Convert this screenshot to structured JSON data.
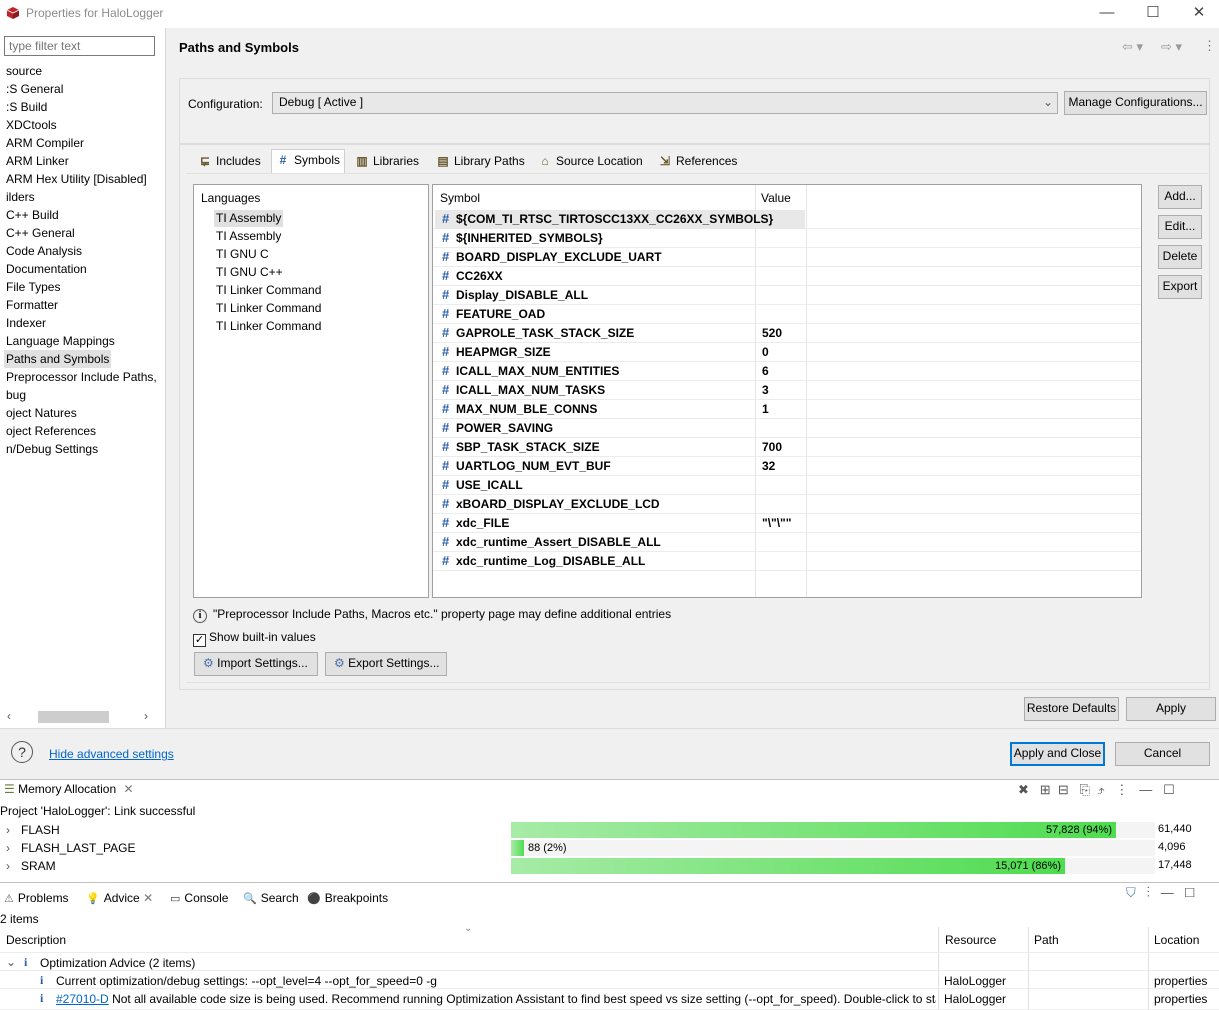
{
  "window": {
    "title": "Properties for HaloLogger",
    "minimize": "—",
    "maximize": "☐",
    "close": "✕"
  },
  "left_nav": {
    "filter_placeholder": "type filter text",
    "items": [
      {
        "label": "source"
      },
      {
        "label": ":S General"
      },
      {
        "label": ":S Build"
      },
      {
        "label": "XDCtools"
      },
      {
        "label": "ARM Compiler"
      },
      {
        "label": "ARM Linker"
      },
      {
        "label": "ARM Hex Utility  [Disabled]"
      },
      {
        "label": "ilders"
      },
      {
        "label": "C++ Build"
      },
      {
        "label": "C++ General"
      },
      {
        "label": "Code Analysis"
      },
      {
        "label": "Documentation"
      },
      {
        "label": "File Types"
      },
      {
        "label": "Formatter"
      },
      {
        "label": "Indexer"
      },
      {
        "label": "Language Mappings"
      },
      {
        "label": "Paths and Symbols"
      },
      {
        "label": "Preprocessor Include Paths,"
      },
      {
        "label": "bug"
      },
      {
        "label": "oject Natures"
      },
      {
        "label": "oject References"
      },
      {
        "label": "n/Debug Settings"
      }
    ],
    "selected_index": 16
  },
  "page": {
    "title": "Paths and Symbols",
    "config_label": "Configuration:",
    "config_value": "Debug  [ Active ]",
    "manage_button": "Manage Configurations...",
    "tabs": [
      {
        "label": "Includes",
        "icon": "includes-icon"
      },
      {
        "label": "Symbols",
        "icon": "hash-icon"
      },
      {
        "label": "Libraries",
        "icon": "libraries-icon"
      },
      {
        "label": "Library Paths",
        "icon": "library-paths-icon"
      },
      {
        "label": "Source Location",
        "icon": "source-location-icon"
      },
      {
        "label": "References",
        "icon": "references-icon"
      }
    ],
    "active_tab": 1,
    "languages_header": "Languages",
    "languages": [
      "TI Assembly",
      "TI Assembly",
      "TI GNU C",
      "TI GNU C++",
      "TI Linker Command",
      "TI Linker Command",
      "TI Linker Command"
    ],
    "selected_language": 0,
    "symbol_header": "Symbol",
    "value_header": "Value",
    "symbols": [
      {
        "name": "${COM_TI_RTSC_TIRTOSCC13XX_CC26XX_SYMBOLS}",
        "value": ""
      },
      {
        "name": "${INHERITED_SYMBOLS}",
        "value": ""
      },
      {
        "name": "BOARD_DISPLAY_EXCLUDE_UART",
        "value": ""
      },
      {
        "name": "CC26XX",
        "value": ""
      },
      {
        "name": "Display_DISABLE_ALL",
        "value": ""
      },
      {
        "name": "FEATURE_OAD",
        "value": ""
      },
      {
        "name": "GAPROLE_TASK_STACK_SIZE",
        "value": "520"
      },
      {
        "name": "HEAPMGR_SIZE",
        "value": "0"
      },
      {
        "name": "ICALL_MAX_NUM_ENTITIES",
        "value": "6"
      },
      {
        "name": "ICALL_MAX_NUM_TASKS",
        "value": "3"
      },
      {
        "name": "MAX_NUM_BLE_CONNS",
        "value": "1"
      },
      {
        "name": "POWER_SAVING",
        "value": ""
      },
      {
        "name": "SBP_TASK_STACK_SIZE",
        "value": "700"
      },
      {
        "name": "UARTLOG_NUM_EVT_BUF",
        "value": "32"
      },
      {
        "name": "USE_ICALL",
        "value": ""
      },
      {
        "name": "xBOARD_DISPLAY_EXCLUDE_LCD",
        "value": ""
      },
      {
        "name": "xdc_FILE",
        "value": "\"\\\"\\\"\""
      },
      {
        "name": "xdc_runtime_Assert_DISABLE_ALL",
        "value": ""
      },
      {
        "name": "xdc_runtime_Log_DISABLE_ALL",
        "value": ""
      }
    ],
    "side_buttons": [
      "Add...",
      "Edit...",
      "Delete",
      "Export"
    ],
    "info_text": "\"Preprocessor Include Paths, Macros etc.\" property page may define additional entries",
    "show_builtin_label": "Show built-in values",
    "show_builtin_checked": true,
    "import_button": "Import Settings...",
    "export_button": "Export Settings...",
    "restore_defaults": "Restore Defaults",
    "apply": "Apply"
  },
  "dialog": {
    "hide_advanced": "Hide advanced settings",
    "apply_close": "Apply and Close",
    "cancel": "Cancel"
  },
  "memory_view": {
    "tab_label": "Memory Allocation",
    "status": "Project 'HaloLogger': Link successful",
    "rows": [
      {
        "name": "FLASH",
        "label": "57,828 (94%)",
        "fraction": 0.94,
        "total": "61,440"
      },
      {
        "name": "FLASH_LAST_PAGE",
        "label": "88 (2%)",
        "fraction": 0.02,
        "total": "4,096"
      },
      {
        "name": "SRAM",
        "label": "15,071 (86%)",
        "fraction": 0.86,
        "total": "17,448"
      }
    ]
  },
  "advice_view": {
    "tabs": [
      "Problems",
      "Advice",
      "Console",
      "Search",
      "Breakpoints"
    ],
    "active_tab": 1,
    "count": "2 items",
    "columns": [
      "Description",
      "Resource",
      "Path",
      "Location"
    ],
    "group": "Optimization Advice (2 items)",
    "rows": [
      {
        "link": "",
        "desc": "Current optimization/debug settings:  --opt_level=4  --opt_for_speed=0   -g",
        "resource": "HaloLogger",
        "path": "",
        "location": "properties"
      },
      {
        "link": "#27010-D",
        "desc": "Not all available code size is being used. Recommend running Optimization Assistant to find best speed vs size setting (--opt_for_speed). Double-click to start",
        "resource": "HaloLogger",
        "path": "",
        "location": "properties"
      }
    ]
  }
}
